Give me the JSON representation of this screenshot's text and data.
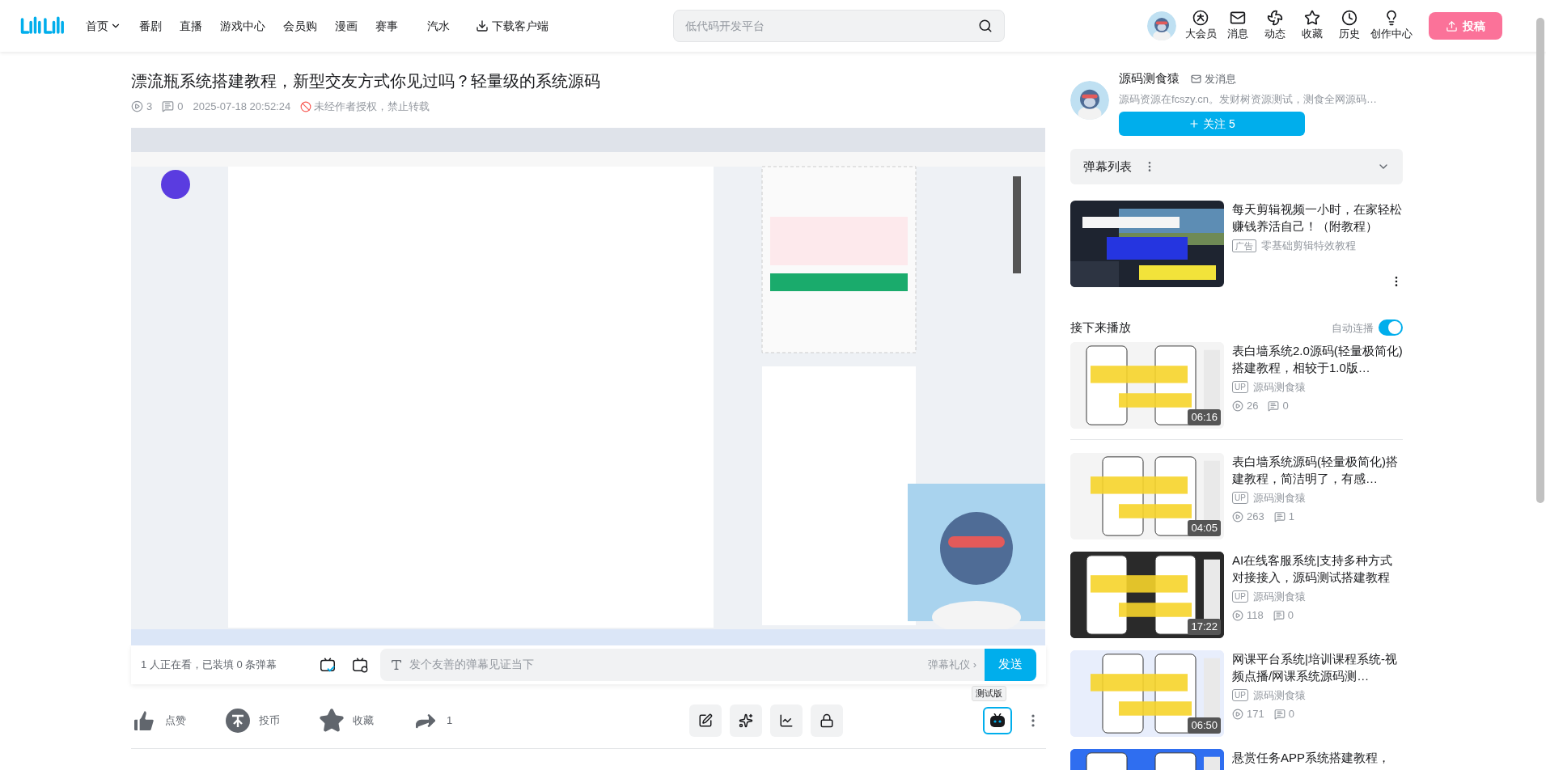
{
  "header": {
    "nav": [
      {
        "label": "首页",
        "dropdown": true
      },
      {
        "label": "番剧",
        "dropdown": false
      },
      {
        "label": "直播",
        "dropdown": false
      },
      {
        "label": "游戏中心",
        "dropdown": false
      },
      {
        "label": "会员购",
        "dropdown": false
      },
      {
        "label": "漫画",
        "dropdown": false
      },
      {
        "label": "赛事",
        "dropdown": false
      },
      {
        "label": "汽水",
        "dropdown": false
      }
    ],
    "download": "下载客户端",
    "search": {
      "placeholder": "低代码开发平台"
    },
    "icons": [
      {
        "kind": "vip",
        "label": "大会员"
      },
      {
        "kind": "mail",
        "label": "消息"
      },
      {
        "kind": "fan",
        "label": "动态"
      },
      {
        "kind": "star",
        "label": "收藏"
      },
      {
        "kind": "clock",
        "label": "历史"
      },
      {
        "kind": "bulb",
        "label": "创作中心"
      }
    ],
    "upload": "投稿"
  },
  "video": {
    "title": "漂流瓶系统搭建教程，新型交友方式你见过吗？轻量级的系统源码",
    "plays": "3",
    "danmaku": "0",
    "date": "2025-07-18 20:52:24",
    "notice": "未经作者授权，禁止转载",
    "viewers": "1 人正在看，已装填 0 条弹幕",
    "danmaku_placeholder": "发个友善的弹幕见证当下",
    "etiquette": "弹幕礼仪",
    "etiquette_arrow": "›",
    "send": "发送"
  },
  "actions": [
    {
      "kind": "like",
      "label": "点赞"
    },
    {
      "kind": "coin",
      "label": "投币"
    },
    {
      "kind": "fav",
      "label": "收藏"
    },
    {
      "kind": "share",
      "label": "1"
    }
  ],
  "beta": "测试版",
  "uploader": {
    "name": "源码测食猿",
    "message": "发消息",
    "bio": "源码资源在fcszy.cn。发财树资源测试，测食全网源码…",
    "follow": "关注 5"
  },
  "danmaku_list": {
    "title": "弹幕列表"
  },
  "ad": {
    "title": "每天剪辑视频一小时，在家轻松赚钱养活自己！（附教程）",
    "tag": "广告",
    "source": "零基础剪辑特效教程"
  },
  "next": {
    "title": "接下来播放",
    "autoplay_label": "自动连播",
    "autoplay": true
  },
  "list": [
    {
      "title": "表白墙系统2.0源码(轻量极简化)搭建教程，相较于1.0版…",
      "up_badge": "UP",
      "author": "源码测食猿",
      "plays": "26",
      "danmaku": "0",
      "duration": "06:16",
      "color": "#f4f4f4"
    },
    {
      "title": "表白墙系统源码(轻量极简化)搭建教程，简洁明了，有感…",
      "up_badge": "UP",
      "author": "源码测食猿",
      "plays": "263",
      "danmaku": "1",
      "duration": "04:05",
      "color": "#f4f4f4"
    },
    {
      "title": "AI在线客服系统|支持多种方式对接接入，源码测试搭建教程",
      "up_badge": "UP",
      "author": "源码测食猿",
      "plays": "118",
      "danmaku": "0",
      "duration": "17:22",
      "color": "#2a2a2a"
    },
    {
      "title": "网课平台系统|培训课程系统-视频点播/网课系统源码测…",
      "up_badge": "UP",
      "author": "源码测食猿",
      "plays": "171",
      "danmaku": "0",
      "duration": "06:50",
      "color": "#e8eefc"
    },
    {
      "title": "悬赏任务APP系统搭建教程，",
      "color": "#2f6ef0"
    }
  ]
}
